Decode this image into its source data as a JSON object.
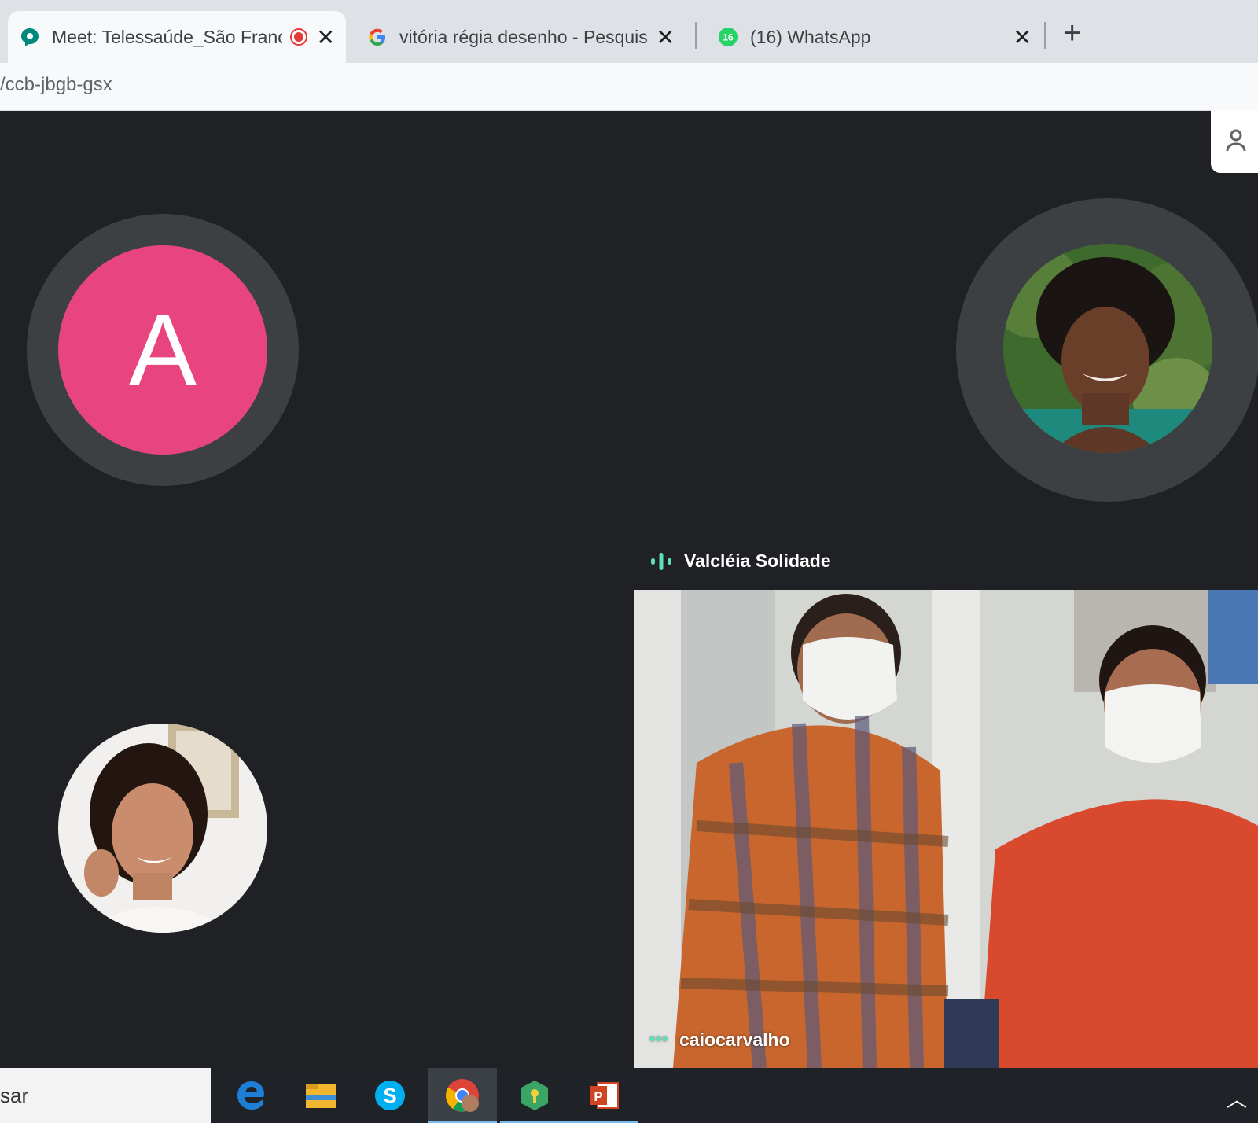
{
  "browser": {
    "tabs": [
      {
        "title": "Meet: Telessaúde_São Franci",
        "favicon": "google-meet-icon",
        "recording": true,
        "active": true
      },
      {
        "title": "vitória régia desenho - Pesquisa",
        "favicon": "google-g-icon",
        "active": false
      },
      {
        "title": "(16) WhatsApp",
        "favicon": "whatsapp-icon",
        "badge": "16",
        "active": false
      }
    ],
    "address": "/ccb-jbgb-gsx"
  },
  "meet": {
    "participants": [
      {
        "type": "initial",
        "initial": "A",
        "color": "#e8447f"
      },
      {
        "type": "photo",
        "description": "woman-curly-hair-avatar"
      },
      {
        "type": "photo",
        "description": "woman-smiling-avatar"
      }
    ],
    "active_speaker": "Valcléia Solidade",
    "video_tile_name": "caiocarvalho"
  },
  "taskbar": {
    "search_text": "sar",
    "apps": [
      "edge-icon",
      "file-explorer-icon",
      "skype-icon",
      "chrome-icon",
      "keepass-icon",
      "powerpoint-icon"
    ]
  },
  "colors": {
    "meet_bg": "#202124",
    "avatar_ring": "#3c4043",
    "speaking_indicator": "#5ce0b8",
    "taskbar_bg": "#1f2328"
  }
}
